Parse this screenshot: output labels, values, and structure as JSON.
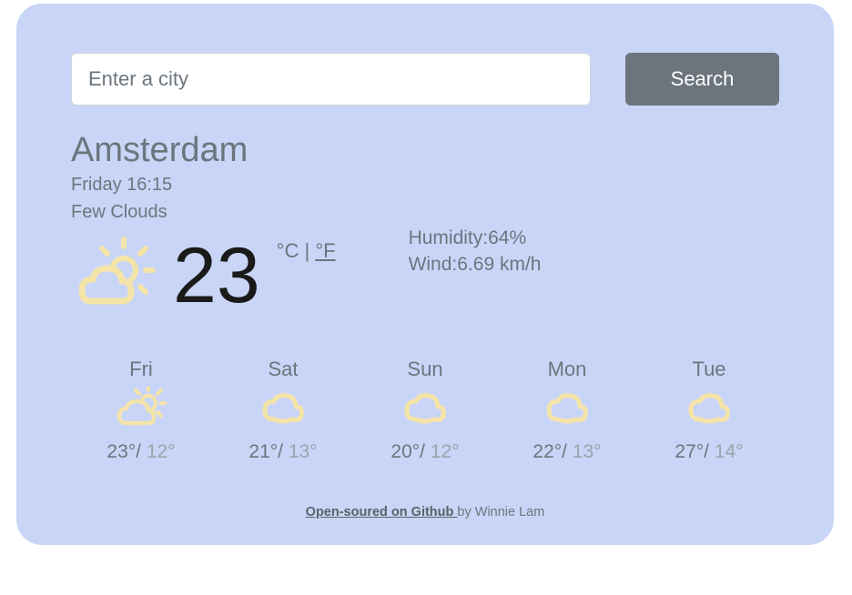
{
  "search": {
    "placeholder": "Enter a city",
    "button_label": "Search"
  },
  "current": {
    "city": "Amsterdam",
    "day_time": "Friday 16:15",
    "condition": "Few Clouds",
    "temperature": "23",
    "unit_c": "°C",
    "unit_sep": " | ",
    "unit_f": "°F",
    "humidity_label": "Humidity:",
    "humidity_value": "64%",
    "wind_label": "Wind:",
    "wind_value": "6.69 km/h",
    "icon": "sun-cloud-icon"
  },
  "forecast": [
    {
      "day": "Fri",
      "high": "23°",
      "sep": "/ ",
      "low": "12°",
      "icon": "sun-cloud-icon"
    },
    {
      "day": "Sat",
      "high": "21°",
      "sep": "/ ",
      "low": "13°",
      "icon": "cloud-icon"
    },
    {
      "day": "Sun",
      "high": "20°",
      "sep": "/ ",
      "low": "12°",
      "icon": "cloud-icon"
    },
    {
      "day": "Mon",
      "high": "22°",
      "sep": "/ ",
      "low": "13°",
      "icon": "cloud-icon"
    },
    {
      "day": "Tue",
      "high": "27°",
      "sep": "/ ",
      "low": "14°",
      "icon": "cloud-icon"
    }
  ],
  "footer": {
    "link_text": "Open-soured on Github ",
    "by_text": "by Winnie Lam"
  }
}
